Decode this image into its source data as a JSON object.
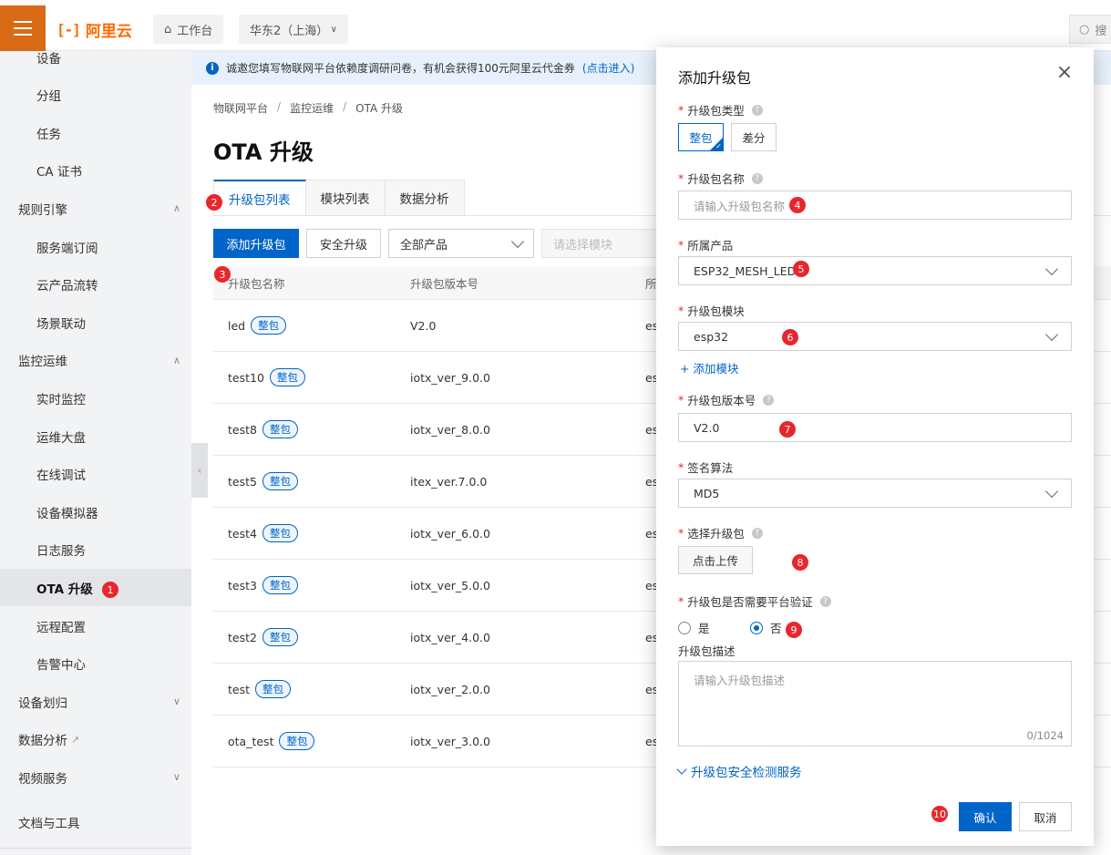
{
  "topbar": {
    "logo": "阿里云",
    "workbench": "工作台",
    "region": "华东2（上海）",
    "search_placeholder": "搜"
  },
  "sidebar": {
    "items": [
      {
        "label": "设备",
        "type": "sub"
      },
      {
        "label": "分组",
        "type": "sub"
      },
      {
        "label": "任务",
        "type": "sub"
      },
      {
        "label": "CA 证书",
        "type": "sub"
      },
      {
        "label": "规则引擎",
        "type": "group",
        "chevron": "up"
      },
      {
        "label": "服务端订阅",
        "type": "sub"
      },
      {
        "label": "云产品流转",
        "type": "sub"
      },
      {
        "label": "场景联动",
        "type": "sub"
      },
      {
        "label": "监控运维",
        "type": "group",
        "chevron": "up"
      },
      {
        "label": "实时监控",
        "type": "sub"
      },
      {
        "label": "运维大盘",
        "type": "sub"
      },
      {
        "label": "在线调试",
        "type": "sub"
      },
      {
        "label": "设备模拟器",
        "type": "sub"
      },
      {
        "label": "日志服务",
        "type": "sub"
      },
      {
        "label": "OTA 升级",
        "type": "sub",
        "active": true
      },
      {
        "label": "远程配置",
        "type": "sub"
      },
      {
        "label": "告警中心",
        "type": "sub"
      },
      {
        "label": "设备划归",
        "type": "group",
        "chevron": "down"
      },
      {
        "label": "数据分析",
        "type": "group",
        "external": true
      },
      {
        "label": "视频服务",
        "type": "group",
        "chevron": "down"
      },
      {
        "label": "文档与工具",
        "type": "group"
      }
    ]
  },
  "notice": {
    "text": "诚邀您填写物联网平台依赖度调研问卷，有机会获得100元阿里云代金券",
    "link": "(点击进入)"
  },
  "breadcrumb": [
    "物联网平台",
    "监控运维",
    "OTA 升级"
  ],
  "page_title": "OTA 升级",
  "tabs": [
    "升级包列表",
    "模块列表",
    "数据分析"
  ],
  "toolbar": {
    "add": "添加升级包",
    "secure": "安全升级",
    "product_select": "全部产品",
    "module_select": "请选择模块"
  },
  "table": {
    "headers": [
      "升级包名称",
      "升级包版本号",
      "所"
    ],
    "badge": "整包",
    "rows": [
      {
        "name": "led",
        "version": "V2.0",
        "prod": "es"
      },
      {
        "name": "test10",
        "version": "iotx_ver_9.0.0",
        "prod": "es"
      },
      {
        "name": "test8",
        "version": "iotx_ver_8.0.0",
        "prod": "es"
      },
      {
        "name": "test5",
        "version": "itex_ver.7.0.0",
        "prod": "es"
      },
      {
        "name": "test4",
        "version": "iotx_ver_6.0.0",
        "prod": "es"
      },
      {
        "name": "test3",
        "version": "iotx_ver_5.0.0",
        "prod": "es"
      },
      {
        "name": "test2",
        "version": "iotx_ver_4.0.0",
        "prod": "es"
      },
      {
        "name": "test",
        "version": "iotx_ver_2.0.0",
        "prod": "es"
      },
      {
        "name": "ota_test",
        "version": "iotx_ver_3.0.0",
        "prod": "es"
      }
    ]
  },
  "modal": {
    "title": "添加升级包",
    "type_label": "升级包类型",
    "type_options": [
      "整包",
      "差分"
    ],
    "name_label": "升级包名称",
    "name_placeholder": "请输入升级包名称",
    "product_label": "所属产品",
    "product_value": "ESP32_MESH_LED",
    "module_label": "升级包模块",
    "module_value": "esp32",
    "add_module": "+ 添加模块",
    "version_label": "升级包版本号",
    "version_value": "V2.0",
    "sign_label": "签名算法",
    "sign_value": "MD5",
    "file_label": "选择升级包",
    "upload": "点击上传",
    "verify_label": "升级包是否需要平台验证",
    "verify_yes": "是",
    "verify_no": "否",
    "desc_label": "升级包描述",
    "desc_placeholder": "请输入升级包描述",
    "desc_count": "0/1024",
    "security_link": "升级包安全检测服务",
    "confirm": "确认",
    "cancel": "取消",
    "required_mark": "*"
  },
  "markers": [
    "1",
    "2",
    "3",
    "4",
    "5",
    "6",
    "7",
    "8",
    "9",
    "10"
  ],
  "colors": {
    "primary": "#0064c8",
    "brand": "#ff6a00",
    "marker": "#e8262d"
  }
}
